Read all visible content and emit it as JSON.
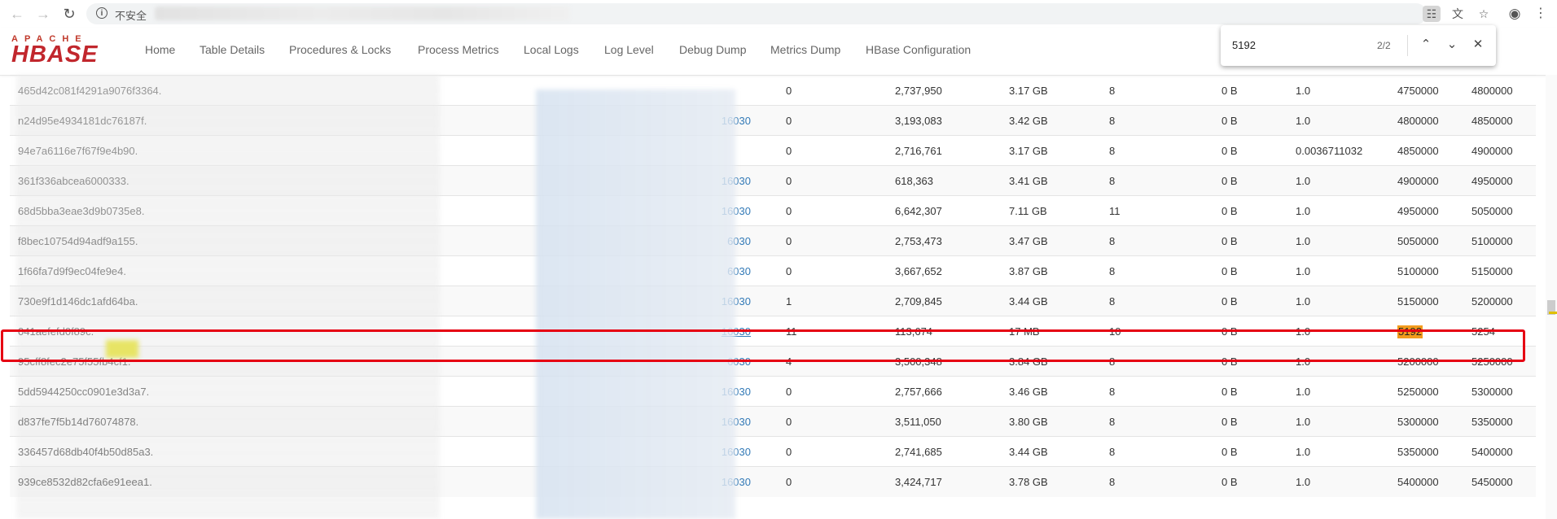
{
  "browser": {
    "security_label": "不安全",
    "find": {
      "query": "5192",
      "count": "2/2"
    }
  },
  "nav": {
    "logo_top": "APACHE",
    "logo_main": "HBASE",
    "items": [
      "Home",
      "Table Details",
      "Procedures & Locks",
      "Process Metrics",
      "Local Logs",
      "Log Level",
      "Debug Dump",
      "Metrics Dump",
      "HBase Configuration"
    ]
  },
  "table": {
    "rows": [
      {
        "name": "465d42c081f4291a9076f3364.",
        "server": "",
        "req": "0",
        "reads": "2,737,950",
        "size": "3.17 GB",
        "files": "8",
        "mem": "0 B",
        "loc": "1.0",
        "start": "4750000",
        "end": "4800000"
      },
      {
        "name": "n24d95e4934181dc76187f.",
        "server": "16030",
        "req": "0",
        "reads": "3,193,083",
        "size": "3.42 GB",
        "files": "8",
        "mem": "0 B",
        "loc": "1.0",
        "start": "4800000",
        "end": "4850000"
      },
      {
        "name": "94e7a6116e7f67f9e4b90.",
        "server": "",
        "req": "0",
        "reads": "2,716,761",
        "size": "3.17 GB",
        "files": "8",
        "mem": "0 B",
        "loc": "0.0036711032",
        "start": "4850000",
        "end": "4900000"
      },
      {
        "name": "361f336abcea6000333.",
        "server": "16030",
        "req": "0",
        "reads": "618,363",
        "size": "3.41 GB",
        "files": "8",
        "mem": "0 B",
        "loc": "1.0",
        "start": "4900000",
        "end": "4950000"
      },
      {
        "name": "68d5bba3eae3d9b0735e8.",
        "server": "16030",
        "req": "0",
        "reads": "6,642,307",
        "size": "7.11 GB",
        "files": "11",
        "mem": "0 B",
        "loc": "1.0",
        "start": "4950000",
        "end": "5050000"
      },
      {
        "name": "f8bec10754d94adf9a155.",
        "server": "6030",
        "req": "0",
        "reads": "2,753,473",
        "size": "3.47 GB",
        "files": "8",
        "mem": "0 B",
        "loc": "1.0",
        "start": "5050000",
        "end": "5100000"
      },
      {
        "name": "1f66fa7d9f9ec04fe9e4.",
        "server": "6030",
        "req": "0",
        "reads": "3,667,652",
        "size": "3.87 GB",
        "files": "8",
        "mem": "0 B",
        "loc": "1.0",
        "start": "5100000",
        "end": "5150000"
      },
      {
        "name": "730e9f1d146dc1afd64ba.",
        "server": "16030",
        "req": "1",
        "reads": "2,709,845",
        "size": "3.44 GB",
        "files": "8",
        "mem": "0 B",
        "loc": "1.0",
        "start": "5150000",
        "end": "5200000"
      },
      {
        "name": "041aefefd0f89c.",
        "server": "16030",
        "req": "11",
        "reads": "113,674",
        "size": "17 MB",
        "files": "10",
        "mem": "0 B",
        "loc": "1.0",
        "start": "5192",
        "end": "5254"
      },
      {
        "name": "95cff8fec2e75f55fb4cf1.",
        "server": "6030",
        "req": "4",
        "reads": "3,500,348",
        "size": "3.84 GB",
        "files": "8",
        "mem": "0 B",
        "loc": "1.0",
        "start": "5200000",
        "end": "5250000"
      },
      {
        "name": "5dd5944250cc0901e3d3a7.",
        "server": "16030",
        "req": "0",
        "reads": "2,757,666",
        "size": "3.46 GB",
        "files": "8",
        "mem": "0 B",
        "loc": "1.0",
        "start": "5250000",
        "end": "5300000"
      },
      {
        "name": "d837fe7f5b14d76074878.",
        "server": "16030",
        "req": "0",
        "reads": "3,511,050",
        "size": "3.80 GB",
        "files": "8",
        "mem": "0 B",
        "loc": "1.0",
        "start": "5300000",
        "end": "5350000"
      },
      {
        "name": "336457d68db40f4b50d85a3.",
        "server": "16030",
        "req": "0",
        "reads": "2,741,685",
        "size": "3.44 GB",
        "files": "8",
        "mem": "0 B",
        "loc": "1.0",
        "start": "5350000",
        "end": "5400000"
      },
      {
        "name": "939ce8532d82cfa6e91eea1.",
        "server": "16030",
        "req": "0",
        "reads": "3,424,717",
        "size": "3.78 GB",
        "files": "8",
        "mem": "0 B",
        "loc": "1.0",
        "start": "5400000",
        "end": "5450000"
      }
    ]
  },
  "colors": {
    "highlight": "#f29b1d",
    "selection_box": "#e60012",
    "link": "#337ab7"
  }
}
